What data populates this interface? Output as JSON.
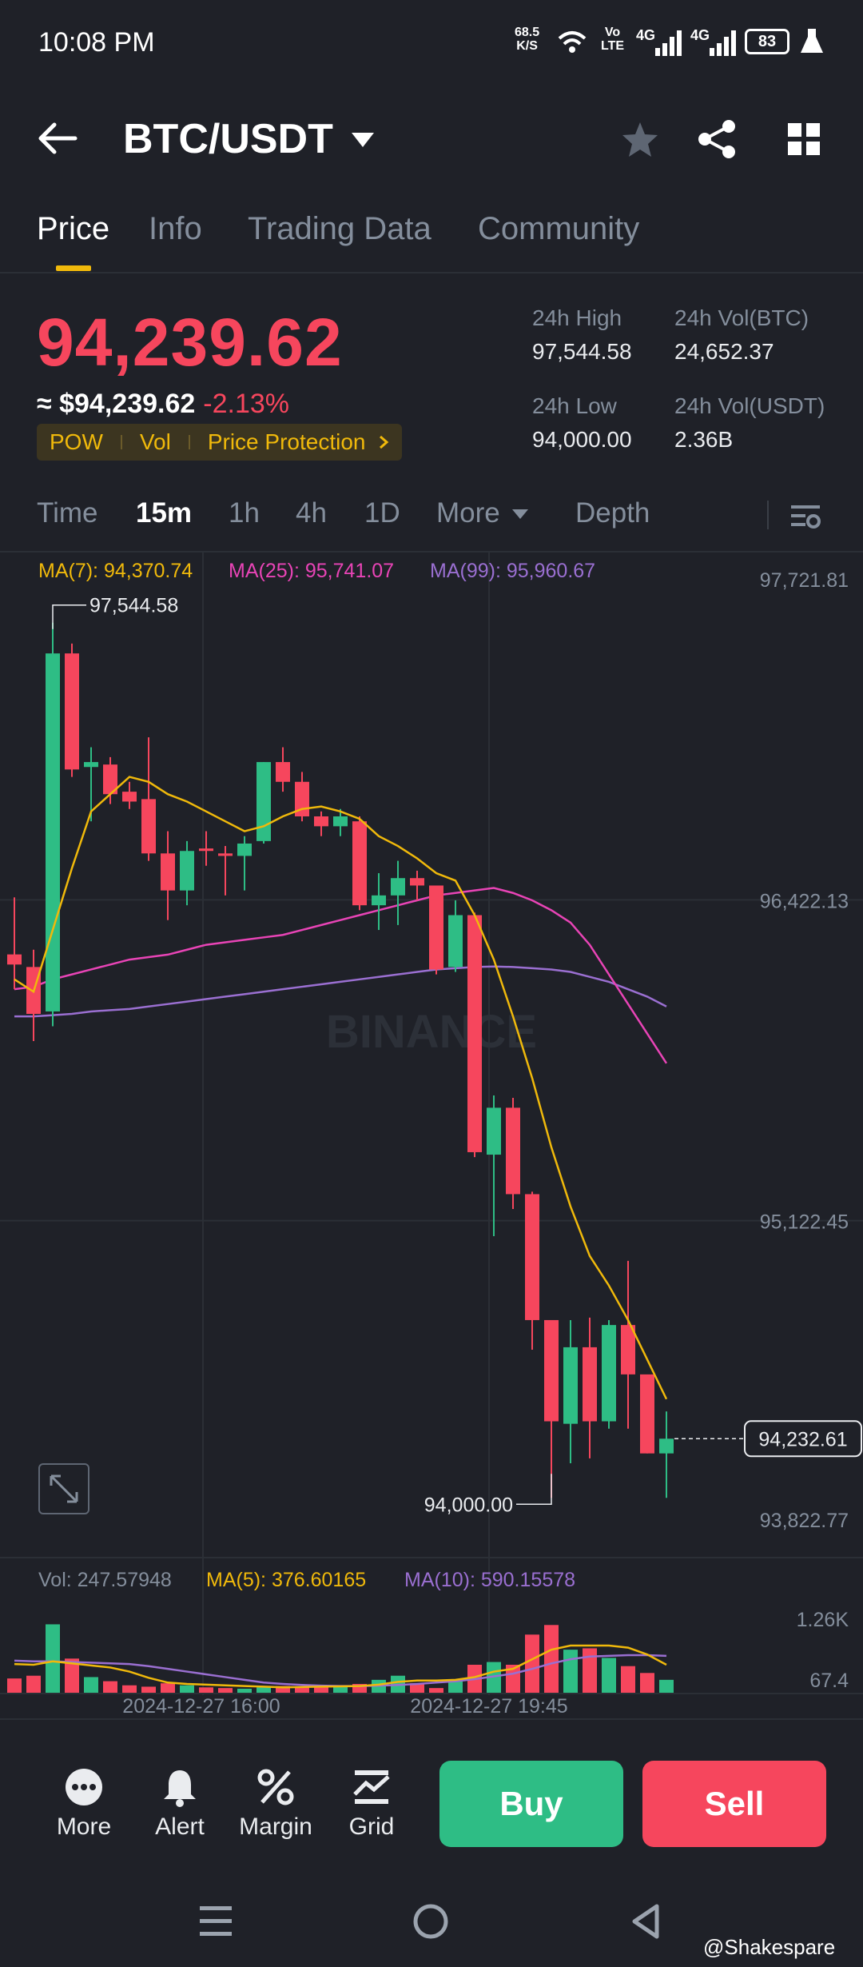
{
  "status_bar": {
    "time": "10:08 PM",
    "speed_value": "68.5",
    "speed_unit": "K/S",
    "volte_top": "Vo",
    "volte_bottom": "LTE",
    "net1": "4G",
    "net2": "4G",
    "battery": "83"
  },
  "header": {
    "pair": "BTC/USDT"
  },
  "tabs": [
    {
      "label": "Price"
    },
    {
      "label": "Info"
    },
    {
      "label": "Trading Data"
    },
    {
      "label": "Community"
    }
  ],
  "ticker": {
    "price": "94,239.62",
    "fiat_price": "≈ $94,239.62",
    "change": "-2.13%",
    "tags": [
      "POW",
      "Vol",
      "Price Protection"
    ],
    "high_label": "24h High",
    "high_value": "97,544.58",
    "low_label": "24h Low",
    "low_value": "94,000.00",
    "vol_btc_label": "24h Vol(BTC)",
    "vol_btc_value": "24,652.37",
    "vol_usdt_label": "24h Vol(USDT)",
    "vol_usdt_value": "2.36B"
  },
  "intervals": [
    {
      "label": "Time"
    },
    {
      "label": "15m"
    },
    {
      "label": "1h"
    },
    {
      "label": "4h"
    },
    {
      "label": "1D"
    },
    {
      "label": "More"
    },
    {
      "label": "Depth"
    }
  ],
  "ma_legend": {
    "ma7": "MA(7): 94,370.74",
    "ma25": "MA(25): 95,741.07",
    "ma99": "MA(99): 95,960.67"
  },
  "vol_legend": {
    "vol": "Vol: 247.57948",
    "ma5": "MA(5): 376.60165",
    "ma10": "MA(10): 590.15578"
  },
  "colors": {
    "up": "#2ebd85",
    "down": "#f6465d",
    "ma7": "#f0b90b",
    "ma25": "#e844b6",
    "ma99": "#9a6fd1",
    "accent": "#f0b90b"
  },
  "chart_data": {
    "type": "candlestick",
    "y_axis_labels": [
      "97,721.81",
      "96,422.13",
      "95,122.45",
      "93,822.77"
    ],
    "ylim": [
      93822.77,
      97721.81
    ],
    "high_marker": "97,544.58",
    "low_marker": "94,000.00",
    "current_price_tag": "94,232.61",
    "watermark": "BINANCE",
    "x_axis_labels": [
      "2024-12-27 16:00",
      "2024-12-27 19:45"
    ],
    "volume_axis_labels": [
      "1.26K",
      "67.4"
    ],
    "candles": [
      {
        "o": 96201,
        "h": 96432,
        "l": 96060,
        "c": 96160
      },
      {
        "o": 96150,
        "h": 96220,
        "l": 95850,
        "c": 95960
      },
      {
        "o": 95970,
        "h": 97544.58,
        "l": 95910,
        "c": 97420
      },
      {
        "o": 97420,
        "h": 97460,
        "l": 96920,
        "c": 96950
      },
      {
        "o": 96960,
        "h": 97040,
        "l": 96740,
        "c": 96980
      },
      {
        "o": 96970,
        "h": 97000,
        "l": 96810,
        "c": 96850
      },
      {
        "o": 96860,
        "h": 96900,
        "l": 96790,
        "c": 96820
      },
      {
        "o": 96830,
        "h": 97080,
        "l": 96580,
        "c": 96610
      },
      {
        "o": 96610,
        "h": 96700,
        "l": 96340,
        "c": 96460
      },
      {
        "o": 96460,
        "h": 96660,
        "l": 96400,
        "c": 96620
      },
      {
        "o": 96630,
        "h": 96700,
        "l": 96560,
        "c": 96620
      },
      {
        "o": 96610,
        "h": 96640,
        "l": 96440,
        "c": 96600
      },
      {
        "o": 96600,
        "h": 96680,
        "l": 96460,
        "c": 96650
      },
      {
        "o": 96660,
        "h": 96980,
        "l": 96650,
        "c": 96980
      },
      {
        "o": 96980,
        "h": 97040,
        "l": 96860,
        "c": 96900
      },
      {
        "o": 96900,
        "h": 96940,
        "l": 96740,
        "c": 96760
      },
      {
        "o": 96760,
        "h": 96780,
        "l": 96680,
        "c": 96720
      },
      {
        "o": 96720,
        "h": 96790,
        "l": 96680,
        "c": 96760
      },
      {
        "o": 96740,
        "h": 96760,
        "l": 96380,
        "c": 96400
      },
      {
        "o": 96400,
        "h": 96530,
        "l": 96300,
        "c": 96440
      },
      {
        "o": 96440,
        "h": 96580,
        "l": 96320,
        "c": 96510
      },
      {
        "o": 96510,
        "h": 96540,
        "l": 96420,
        "c": 96480
      },
      {
        "o": 96480,
        "h": 96460,
        "l": 96120,
        "c": 96140
      },
      {
        "o": 96150,
        "h": 96420,
        "l": 96130,
        "c": 96360
      },
      {
        "o": 96360,
        "h": 96370,
        "l": 95380,
        "c": 95400
      },
      {
        "o": 95390,
        "h": 95630,
        "l": 95060,
        "c": 95580
      },
      {
        "o": 95580,
        "h": 95620,
        "l": 95170,
        "c": 95230
      },
      {
        "o": 95230,
        "h": 95240,
        "l": 94600,
        "c": 94720
      },
      {
        "o": 94720,
        "h": 94710,
        "l": 94000,
        "c": 94310
      },
      {
        "o": 94300,
        "h": 94720,
        "l": 94140,
        "c": 94610
      },
      {
        "o": 94610,
        "h": 94730,
        "l": 94160,
        "c": 94310
      },
      {
        "o": 94310,
        "h": 94720,
        "l": 94280,
        "c": 94700
      },
      {
        "o": 94700,
        "h": 94960,
        "l": 94280,
        "c": 94500
      },
      {
        "o": 94500,
        "h": 94460,
        "l": 94180,
        "c": 94180
      },
      {
        "o": 94180,
        "h": 94350,
        "l": 94000,
        "c": 94239.62
      }
    ],
    "ma7": [
      96100,
      96050,
      96300,
      96550,
      96780,
      96850,
      96920,
      96900,
      96850,
      96820,
      96780,
      96740,
      96700,
      96720,
      96760,
      96790,
      96800,
      96780,
      96750,
      96680,
      96640,
      96590,
      96530,
      96500,
      96360,
      96180,
      95950,
      95700,
      95420,
      95180,
      94980,
      94860,
      94720,
      94560,
      94400
    ],
    "ma25": [
      96060,
      96070,
      96100,
      96120,
      96140,
      96160,
      96180,
      96190,
      96200,
      96220,
      96240,
      96250,
      96260,
      96270,
      96280,
      96300,
      96320,
      96340,
      96360,
      96380,
      96400,
      96420,
      96440,
      96450,
      96460,
      96470,
      96450,
      96420,
      96380,
      96330,
      96240,
      96120,
      96000,
      95880,
      95760
    ],
    "ma99": [
      95950,
      95950,
      95955,
      95960,
      95970,
      95975,
      95980,
      95990,
      96000,
      96010,
      96020,
      96030,
      96040,
      96050,
      96060,
      96070,
      96080,
      96090,
      96100,
      96110,
      96120,
      96130,
      96140,
      96145,
      96150,
      96152,
      96150,
      96145,
      96140,
      96130,
      96110,
      96090,
      96060,
      96030,
      95990
    ],
    "volumes": [
      220,
      260,
      1010,
      510,
      240,
      180,
      120,
      100,
      150,
      120,
      90,
      80,
      70,
      90,
      110,
      100,
      90,
      110,
      140,
      200,
      260,
      150,
      80,
      200,
      420,
      460,
      420,
      860,
      1000,
      640,
      660,
      520,
      400,
      300,
      200
    ],
    "vol_ma5": [
      430,
      420,
      470,
      440,
      410,
      380,
      320,
      230,
      160,
      140,
      130,
      120,
      110,
      100,
      90,
      95,
      100,
      105,
      110,
      130,
      170,
      190,
      190,
      200,
      240,
      320,
      360,
      500,
      640,
      700,
      700,
      700,
      670,
      570,
      420
    ],
    "vol_ma10": [
      480,
      470,
      470,
      460,
      450,
      440,
      430,
      400,
      360,
      320,
      280,
      240,
      200,
      160,
      140,
      125,
      115,
      110,
      110,
      115,
      125,
      140,
      160,
      180,
      210,
      250,
      290,
      360,
      440,
      500,
      540,
      550,
      560,
      560,
      550
    ]
  },
  "bottom_nav": [
    {
      "label": "More"
    },
    {
      "label": "Alert"
    },
    {
      "label": "Margin"
    },
    {
      "label": "Grid"
    }
  ],
  "actions": {
    "buy": "Buy",
    "sell": "Sell"
  },
  "watermark_user": "@Shakespare"
}
